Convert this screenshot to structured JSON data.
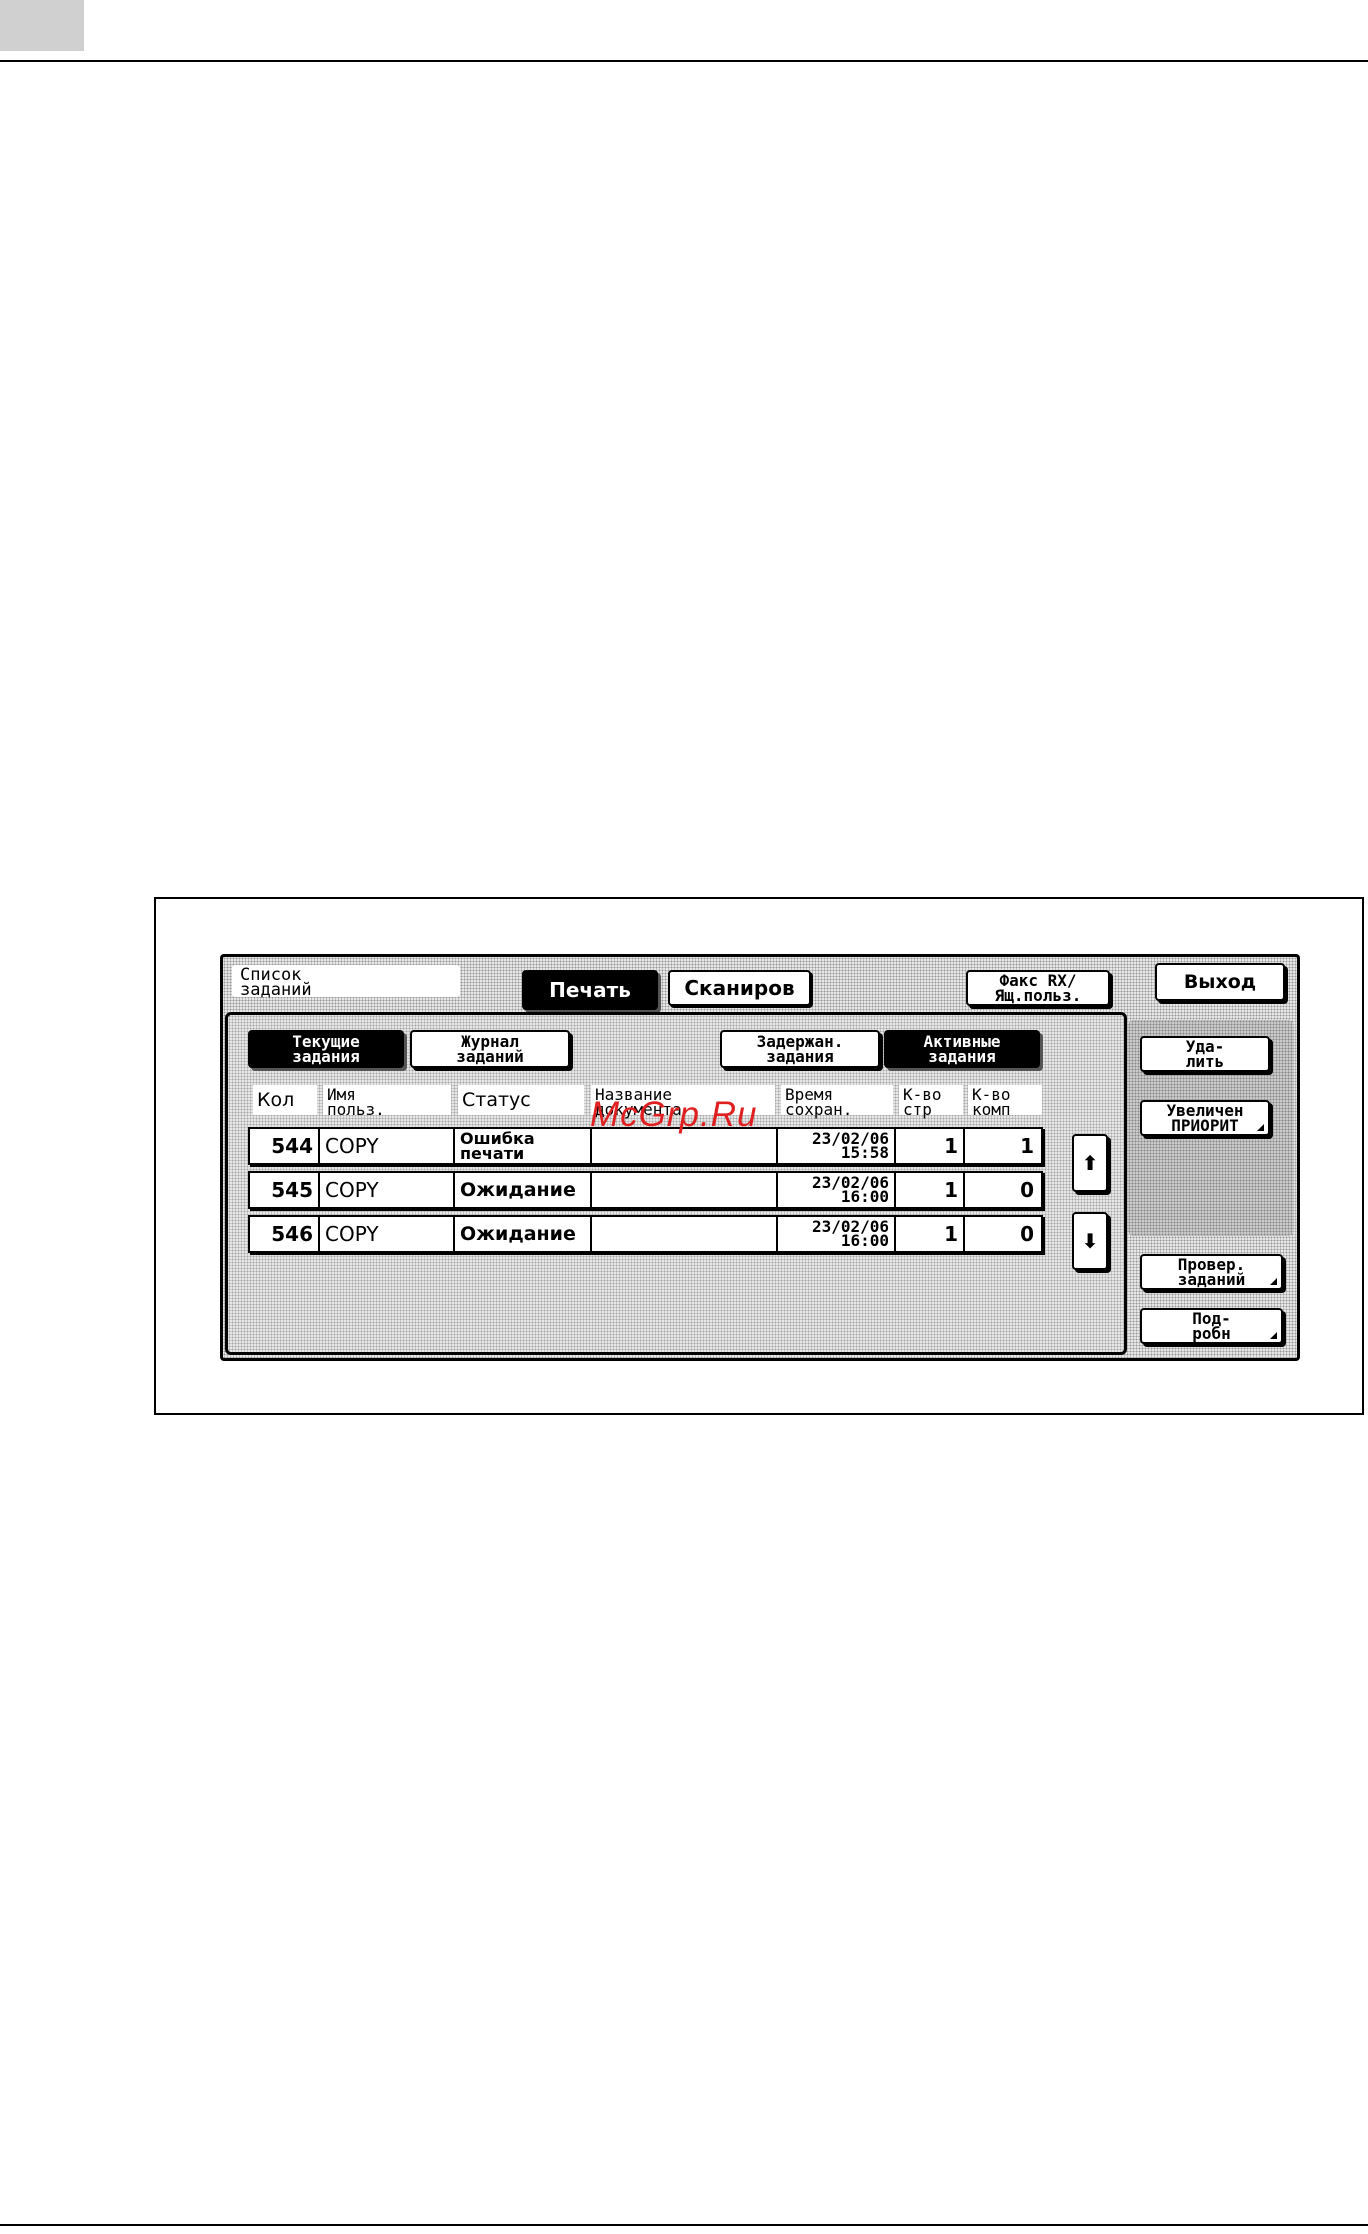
{
  "screen": {
    "title_label": "Список\nзаданий",
    "tabs": {
      "print": "Печать",
      "scan": "Сканиров",
      "fax": "Факс RX/\nЯщ.польз."
    },
    "exit_button": "Выход",
    "subtabs": {
      "current": "Текущие\nзадания",
      "log": "Журнал\nзаданий",
      "held": "Задержан.\nзадания",
      "active": "Активные\nзадания"
    },
    "columns": {
      "num": "Кол",
      "user": "Имя\nпольз.",
      "status": "Статус",
      "doc": "Название\nдокумента",
      "time": "Время\nсохран.",
      "pages": "К-во\nстр",
      "copies": "К-во\nкомп"
    },
    "rows": [
      {
        "num": "544",
        "user": "COPY",
        "status": "Ошибка\nпечати",
        "doc": "",
        "time": "23/02/06\n15:58",
        "pages": "1",
        "copies": "1"
      },
      {
        "num": "545",
        "user": "COPY",
        "status": "Ожидание",
        "doc": "",
        "time": "23/02/06\n16:00",
        "pages": "1",
        "copies": "0"
      },
      {
        "num": "546",
        "user": "COPY",
        "status": "Ожидание",
        "doc": "",
        "time": "23/02/06\n16:00",
        "pages": "1",
        "copies": "0"
      }
    ],
    "side_buttons": {
      "delete": "Уда-\nлить",
      "priority": "Увеличен\nПРИОРИТ",
      "check": "Провер.\nзаданий",
      "details": "Под-\nробн"
    }
  },
  "watermark": "McGrp.Ru",
  "icons": {
    "scroll_up": "arrow-up-icon",
    "scroll_down": "arrow-down-icon"
  }
}
